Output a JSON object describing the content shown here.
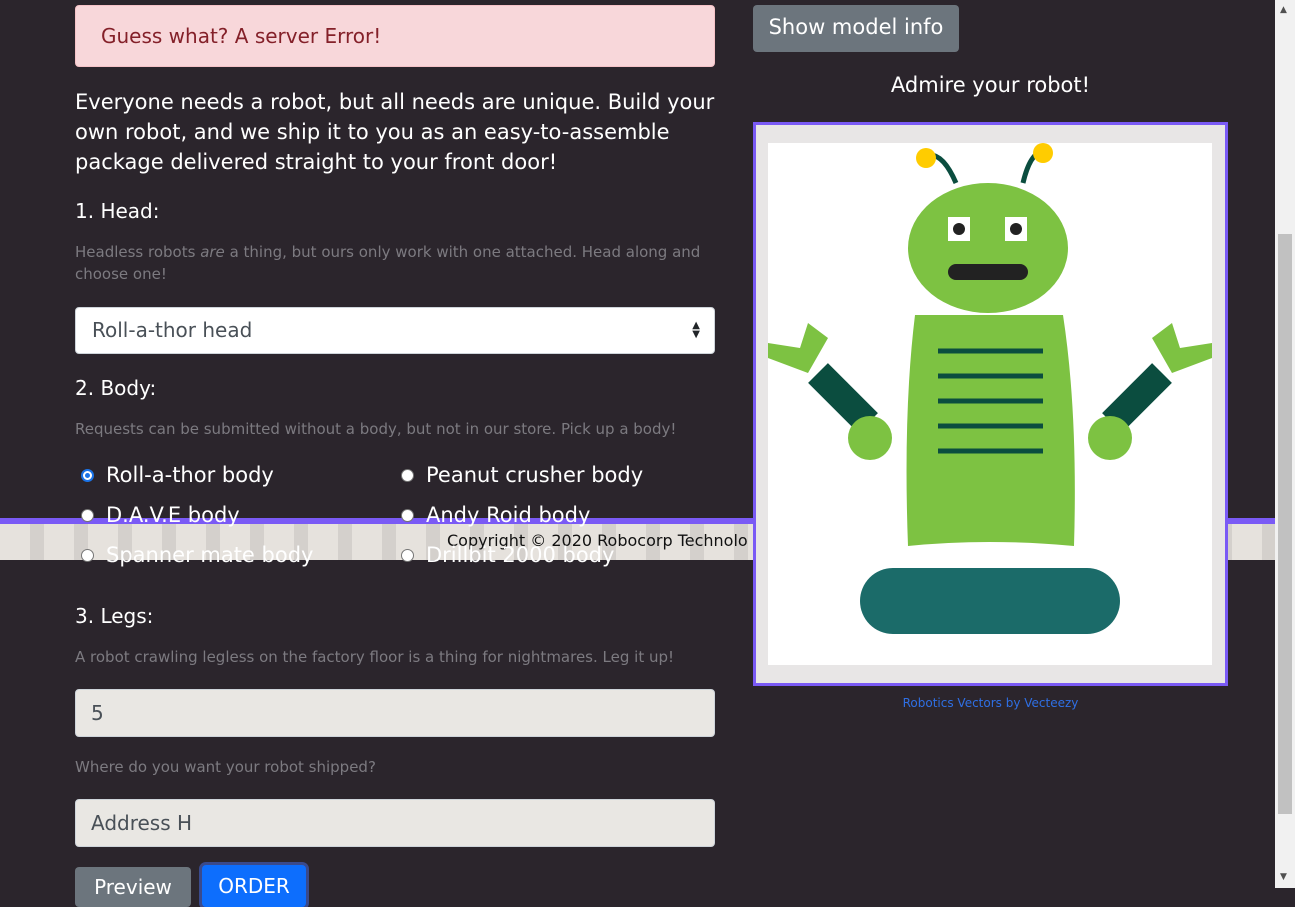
{
  "alert": {
    "text": "Guess what? A server Error!"
  },
  "intro": "Everyone needs a robot, but all needs are unique. Build your own robot, and we ship it to you as an easy-to-assemble package delivered straight to your front door!",
  "head": {
    "title": "1. Head:",
    "help_before": "Headless robots ",
    "help_em": "are",
    "help_after": " a thing, but ours only work with one attached. Head along and choose one!",
    "selected": "Roll-a-thor head"
  },
  "body": {
    "title": "2. Body:",
    "help": "Requests can be submitted without a body, but not in our store. Pick up a body!",
    "options": [
      "Roll-a-thor body",
      "Peanut crusher body",
      "D.A.V.E body",
      "Andy Roid body",
      "Spanner mate body",
      "Drillbit 2000 body"
    ]
  },
  "legs": {
    "title": "3. Legs:",
    "help": "A robot crawling legless on the factory floor is a thing for nightmares. Leg it up!",
    "value": "5"
  },
  "address": {
    "help": "Where do you want your robot shipped?",
    "value": "Address H"
  },
  "buttons": {
    "preview": "Preview",
    "order": "ORDER",
    "model_info": "Show model info"
  },
  "preview": {
    "title": "Admire your robot!",
    "credit": "Robotics Vectors by Vecteezy"
  },
  "footer": {
    "copyright": "Copyright © 2020 Robocorp Technolo"
  },
  "colors": {
    "accent": "#7a5af5",
    "robot_green": "#7dc242",
    "robot_dark": "#0b4d3f",
    "robot_base": "#1b6b69",
    "antenna_tip": "#ffcc00"
  }
}
